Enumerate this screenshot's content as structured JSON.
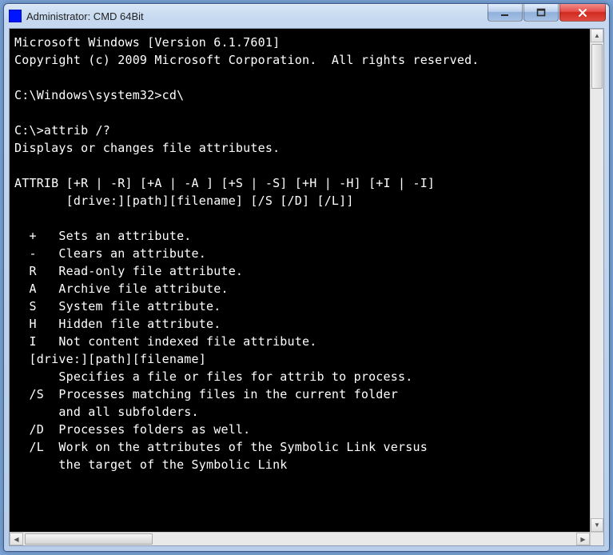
{
  "window": {
    "title": "Administrator: CMD 64Bit"
  },
  "terminal": {
    "lines": [
      "Microsoft Windows [Version 6.1.7601]",
      "Copyright (c) 2009 Microsoft Corporation.  All rights reserved.",
      "",
      "C:\\Windows\\system32>cd\\",
      "",
      "C:\\>attrib /?",
      "Displays or changes file attributes.",
      "",
      "ATTRIB [+R | -R] [+A | -A ] [+S | -S] [+H | -H] [+I | -I]",
      "       [drive:][path][filename] [/S [/D] [/L]]",
      "",
      "  +   Sets an attribute.",
      "  -   Clears an attribute.",
      "  R   Read-only file attribute.",
      "  A   Archive file attribute.",
      "  S   System file attribute.",
      "  H   Hidden file attribute.",
      "  I   Not content indexed file attribute.",
      "  [drive:][path][filename]",
      "      Specifies a file or files for attrib to process.",
      "  /S  Processes matching files in the current folder",
      "      and all subfolders.",
      "  /D  Processes folders as well.",
      "  /L  Work on the attributes of the Symbolic Link versus",
      "      the target of the Symbolic Link"
    ]
  }
}
